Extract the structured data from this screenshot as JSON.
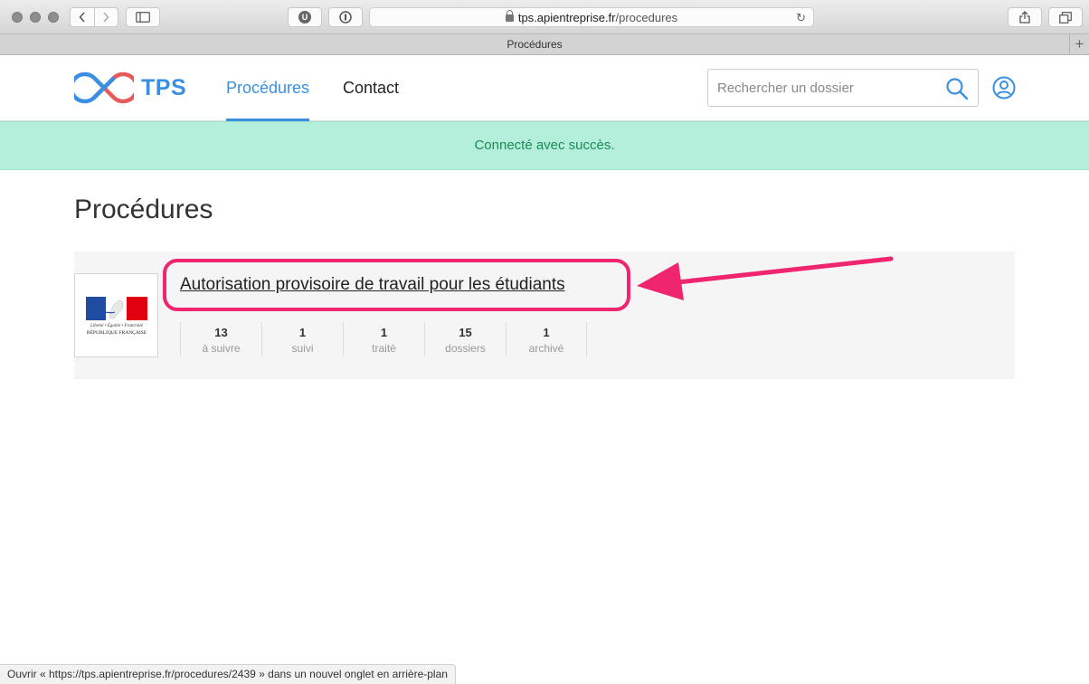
{
  "browser": {
    "url_domain": "tps.apientreprise.fr",
    "url_path": "/procedures",
    "tab_title": "Procédures",
    "status_text": "Ouvrir « https://tps.apientreprise.fr/procedures/2439 » dans un nouvel onglet en arrière-plan",
    "extension_1": "U"
  },
  "header": {
    "logo_text": "TPS",
    "nav": {
      "procedures": "Procédures",
      "contact": "Contact"
    },
    "search_placeholder": "Rechercher un dossier"
  },
  "flash": {
    "message": "Connecté avec succès."
  },
  "page": {
    "title": "Procédures"
  },
  "procedure": {
    "name": "Autorisation provisoire de travail pour les étudiants",
    "logo_caption_1": "Liberté • Égalité • Fraternité",
    "logo_caption_2": "RÉPUBLIQUE FRANÇAISE",
    "stats": [
      {
        "value": "13",
        "label": "à suivre"
      },
      {
        "value": "1",
        "label": "suivi"
      },
      {
        "value": "1",
        "label": "traité"
      },
      {
        "value": "15",
        "label": "dossiers"
      },
      {
        "value": "1",
        "label": "archivé"
      }
    ]
  },
  "colors": {
    "primary": "#3b8fe0",
    "flash_bg": "#b4efdb",
    "flash_text": "#1e8a5a",
    "annotation": "#f0256f"
  }
}
